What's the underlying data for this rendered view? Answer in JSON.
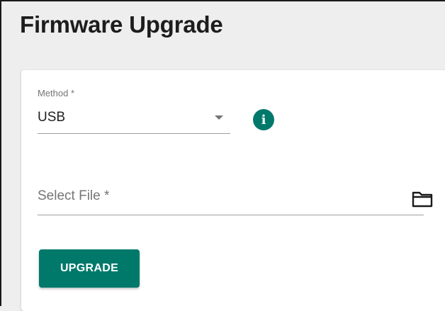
{
  "page": {
    "title": "Firmware Upgrade"
  },
  "method": {
    "label": "Method *",
    "value": "USB",
    "info_icon": "info-icon",
    "dropdown_icon": "arrow-drop-down-icon"
  },
  "file": {
    "placeholder": "Select File *",
    "browse_icon": "folder-icon"
  },
  "actions": {
    "upgrade_label": "UPGRADE"
  },
  "colors": {
    "accent": "#00796b",
    "background": "#eeeeee",
    "card": "#ffffff",
    "label": "#757575",
    "text": "#212121"
  }
}
